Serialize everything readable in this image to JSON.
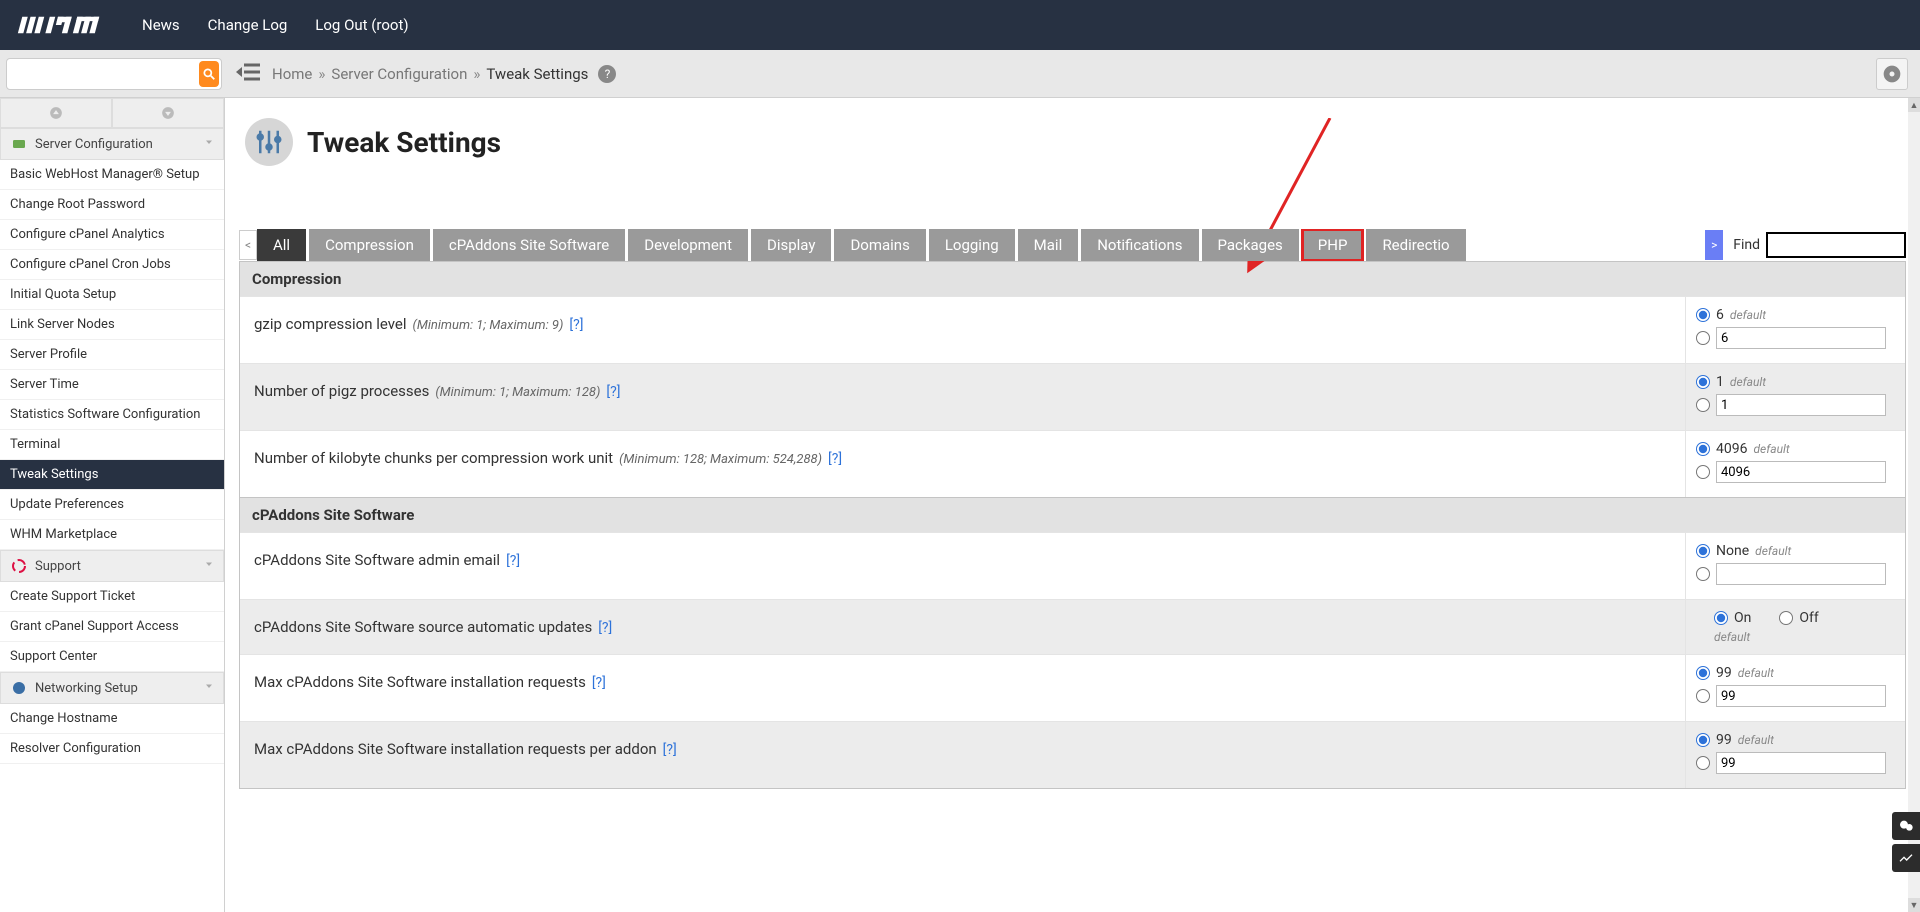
{
  "topnav": {
    "links": [
      "News",
      "Change Log",
      "Log Out (root)"
    ]
  },
  "breadcrumb": {
    "items": [
      "Home",
      "Server Configuration",
      "Tweak Settings"
    ]
  },
  "page": {
    "title": "Tweak Settings"
  },
  "sidebar": {
    "categories": [
      {
        "name": "Server Configuration",
        "items": [
          "Basic WebHost Manager® Setup",
          "Change Root Password",
          "Configure cPanel Analytics",
          "Configure cPanel Cron Jobs",
          "Initial Quota Setup",
          "Link Server Nodes",
          "Server Profile",
          "Server Time",
          "Statistics Software Configuration",
          "Terminal",
          "Tweak Settings",
          "Update Preferences",
          "WHM Marketplace"
        ],
        "active": "Tweak Settings"
      },
      {
        "name": "Support",
        "items": [
          "Create Support Ticket",
          "Grant cPanel Support Access",
          "Support Center"
        ]
      },
      {
        "name": "Networking Setup",
        "items": [
          "Change Hostname",
          "Resolver Configuration"
        ]
      }
    ]
  },
  "tabs": {
    "list": [
      "All",
      "Compression",
      "cPAddons Site Software",
      "Development",
      "Display",
      "Domains",
      "Logging",
      "Mail",
      "Notifications",
      "Packages",
      "PHP",
      "Redirectio"
    ],
    "active": "All",
    "highlighted": "PHP",
    "find_label": "Find"
  },
  "sections": [
    {
      "title": "Compression",
      "rows": [
        {
          "label": "gzip compression level",
          "hint": "(Minimum: 1; Maximum: 9)",
          "help": "[?]",
          "control": {
            "type": "default_or_custom",
            "default": "6",
            "custom": "6"
          }
        },
        {
          "label": "Number of pigz processes",
          "hint": "(Minimum: 1; Maximum: 128)",
          "help": "[?]",
          "control": {
            "type": "default_or_custom",
            "default": "1",
            "custom": "1"
          }
        },
        {
          "label": "Number of kilobyte chunks per compression work unit",
          "hint": "(Minimum: 128; Maximum: 524,288)",
          "help": "[?]",
          "control": {
            "type": "default_or_custom",
            "default": "4096",
            "custom": "4096"
          }
        }
      ]
    },
    {
      "title": "cPAddons Site Software",
      "rows": [
        {
          "label": "cPAddons Site Software admin email",
          "hint": "",
          "help": "[?]",
          "control": {
            "type": "default_or_custom",
            "default": "None",
            "custom": ""
          }
        },
        {
          "label": "cPAddons Site Software source automatic updates",
          "hint": "",
          "help": "[?]",
          "control": {
            "type": "onoff",
            "on_label": "On",
            "off_label": "Off",
            "default_label": "default"
          }
        },
        {
          "label": "Max cPAddons Site Software installation requests",
          "hint": "",
          "help": "[?]",
          "control": {
            "type": "default_or_custom",
            "default": "99",
            "custom": "99"
          }
        },
        {
          "label": "Max cPAddons Site Software installation requests per addon",
          "hint": "",
          "help": "[?]",
          "control": {
            "type": "default_or_custom",
            "default": "99",
            "custom": "99"
          }
        }
      ]
    }
  ],
  "labels": {
    "default": "default"
  }
}
